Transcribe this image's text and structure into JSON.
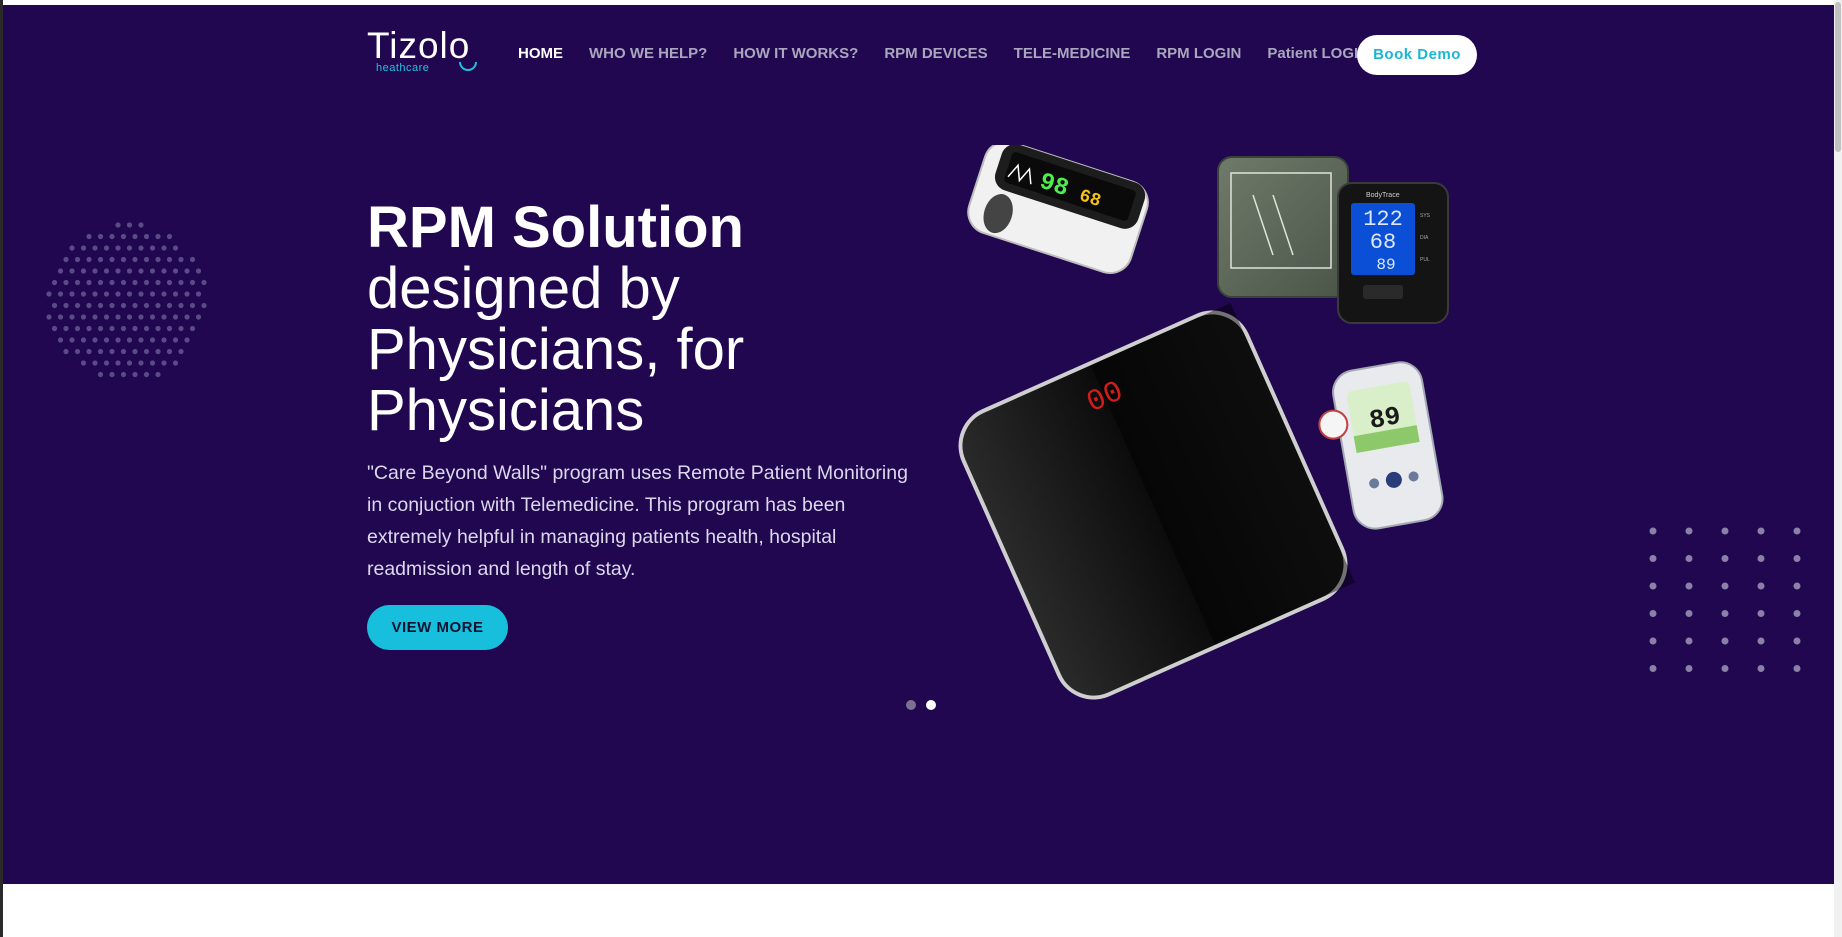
{
  "header": {
    "logo_text": "Tizolo",
    "logo_sub": "heathcare",
    "nav": [
      {
        "label": "HOME",
        "active": true
      },
      {
        "label": "WHO WE HELP?"
      },
      {
        "label": "HOW IT WORKS?"
      },
      {
        "label": "RPM DEVICES"
      },
      {
        "label": "TELE-MEDICINE"
      },
      {
        "label": "RPM LOGIN"
      },
      {
        "label": "Patient LOGIN"
      }
    ],
    "cta_label": "Book Demo"
  },
  "hero": {
    "title_bold": "RPM Solution",
    "title_rest": "designed by Physicians, for Physicians",
    "description": "\"Care Beyond Walls\" program uses Remote Patient Monitoring in conjuction with Telemedicine. This program has been extremely helpful in managing patients health, hospital readmission and length of stay.",
    "button_label": "VIEW MORE",
    "slides": 2,
    "active_slide": 2
  },
  "devices": {
    "oximeter": {
      "value1": "98",
      "value2": "68"
    },
    "bp_monitor": {
      "brand": "BodyTrace",
      "sys": "122",
      "dia": "68",
      "pul": "89",
      "labels": [
        "SYS",
        "DIA",
        "PUL"
      ]
    },
    "scale": {
      "display": "00"
    },
    "glucometer": {
      "value": "89"
    }
  },
  "colors": {
    "background": "#210750",
    "accent": "#17bfdd",
    "nav_text": "#a9a6bd"
  }
}
